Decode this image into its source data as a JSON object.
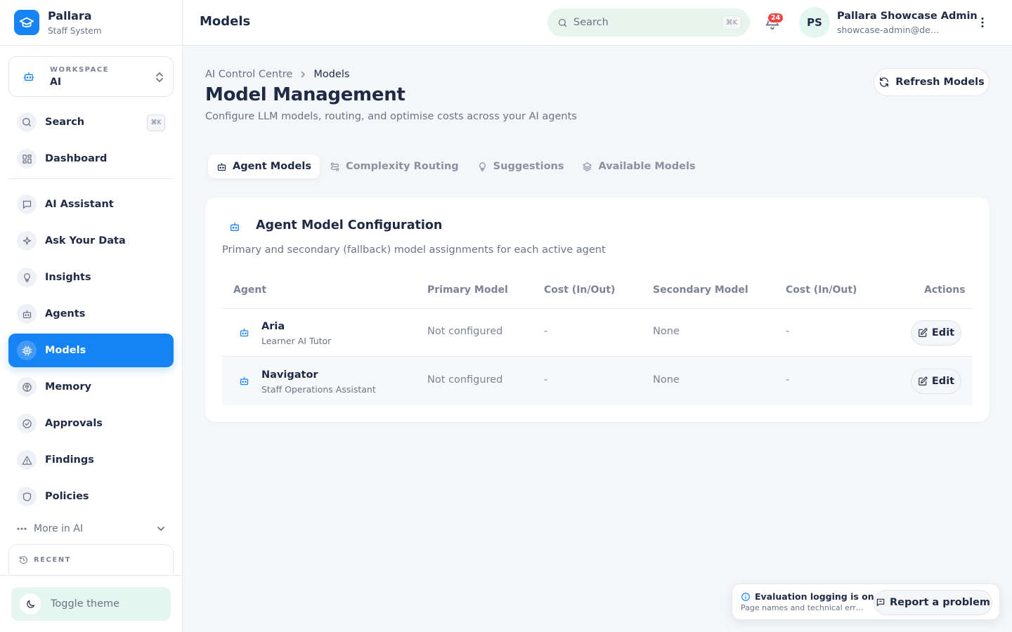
{
  "brand": {
    "name": "Pallara",
    "subtitle": "Staff System"
  },
  "workspace": {
    "label": "WORKSPACE",
    "value": "AI"
  },
  "sidebar": {
    "search": {
      "label": "Search",
      "shortcut": "⌘K"
    },
    "items": [
      {
        "label": "Dashboard",
        "icon": "dashboard-icon"
      },
      {
        "label": "AI Assistant",
        "icon": "chat-icon"
      },
      {
        "label": "Ask Your Data",
        "icon": "sparkle-icon"
      },
      {
        "label": "Insights",
        "icon": "lightbulb-icon"
      },
      {
        "label": "Agents",
        "icon": "robot-icon"
      },
      {
        "label": "Models",
        "icon": "cpu-icon",
        "active": true
      },
      {
        "label": "Memory",
        "icon": "brain-icon"
      },
      {
        "label": "Approvals",
        "icon": "check-circle-icon"
      },
      {
        "label": "Findings",
        "icon": "alert-triangle-icon"
      },
      {
        "label": "Policies",
        "icon": "shield-icon"
      }
    ],
    "more_label": "More in AI",
    "recent_label": "RECENT",
    "toggle_theme": "Toggle theme"
  },
  "header": {
    "title": "Models",
    "search_placeholder": "Search",
    "search_shortcut": "⌘K",
    "notification_count": "24",
    "user_initials": "PS",
    "user_name": "Pallara Showcase Admin",
    "user_email": "showcase-admin@demo.pallara.com"
  },
  "page": {
    "breadcrumb": [
      "AI Control Centre",
      "Models"
    ],
    "title": "Model Management",
    "subtitle": "Configure LLM models, routing, and optimise costs across your AI agents",
    "refresh_label": "Refresh Models"
  },
  "tabs": [
    {
      "label": "Agent Models",
      "icon": "robot-icon",
      "active": true
    },
    {
      "label": "Complexity Routing",
      "icon": "route-icon"
    },
    {
      "label": "Suggestions",
      "icon": "lightbulb-icon"
    },
    {
      "label": "Available Models",
      "icon": "layers-icon"
    }
  ],
  "card": {
    "title": "Agent Model Configuration",
    "description": "Primary and secondary (fallback) model assignments for each active agent",
    "columns": [
      "Agent",
      "Primary Model",
      "Cost (In/Out)",
      "Secondary Model",
      "Cost (In/Out)",
      "Actions"
    ],
    "rows": [
      {
        "name": "Aria",
        "role": "Learner AI Tutor",
        "primary": "Not configured",
        "primary_cost": "-",
        "secondary": "None",
        "secondary_cost": "-",
        "action": "Edit"
      },
      {
        "name": "Navigator",
        "role": "Staff Operations Assistant",
        "primary": "Not configured",
        "primary_cost": "-",
        "secondary": "None",
        "secondary_cost": "-",
        "action": "Edit"
      }
    ]
  },
  "eval_notice": {
    "title": "Evaluation logging is on",
    "description": "Page names and technical errors are logged",
    "report_label": "Report a problem"
  },
  "colors": {
    "accent": "#1683f5",
    "mint": "#e5f5ef",
    "badge": "#ef4444"
  }
}
